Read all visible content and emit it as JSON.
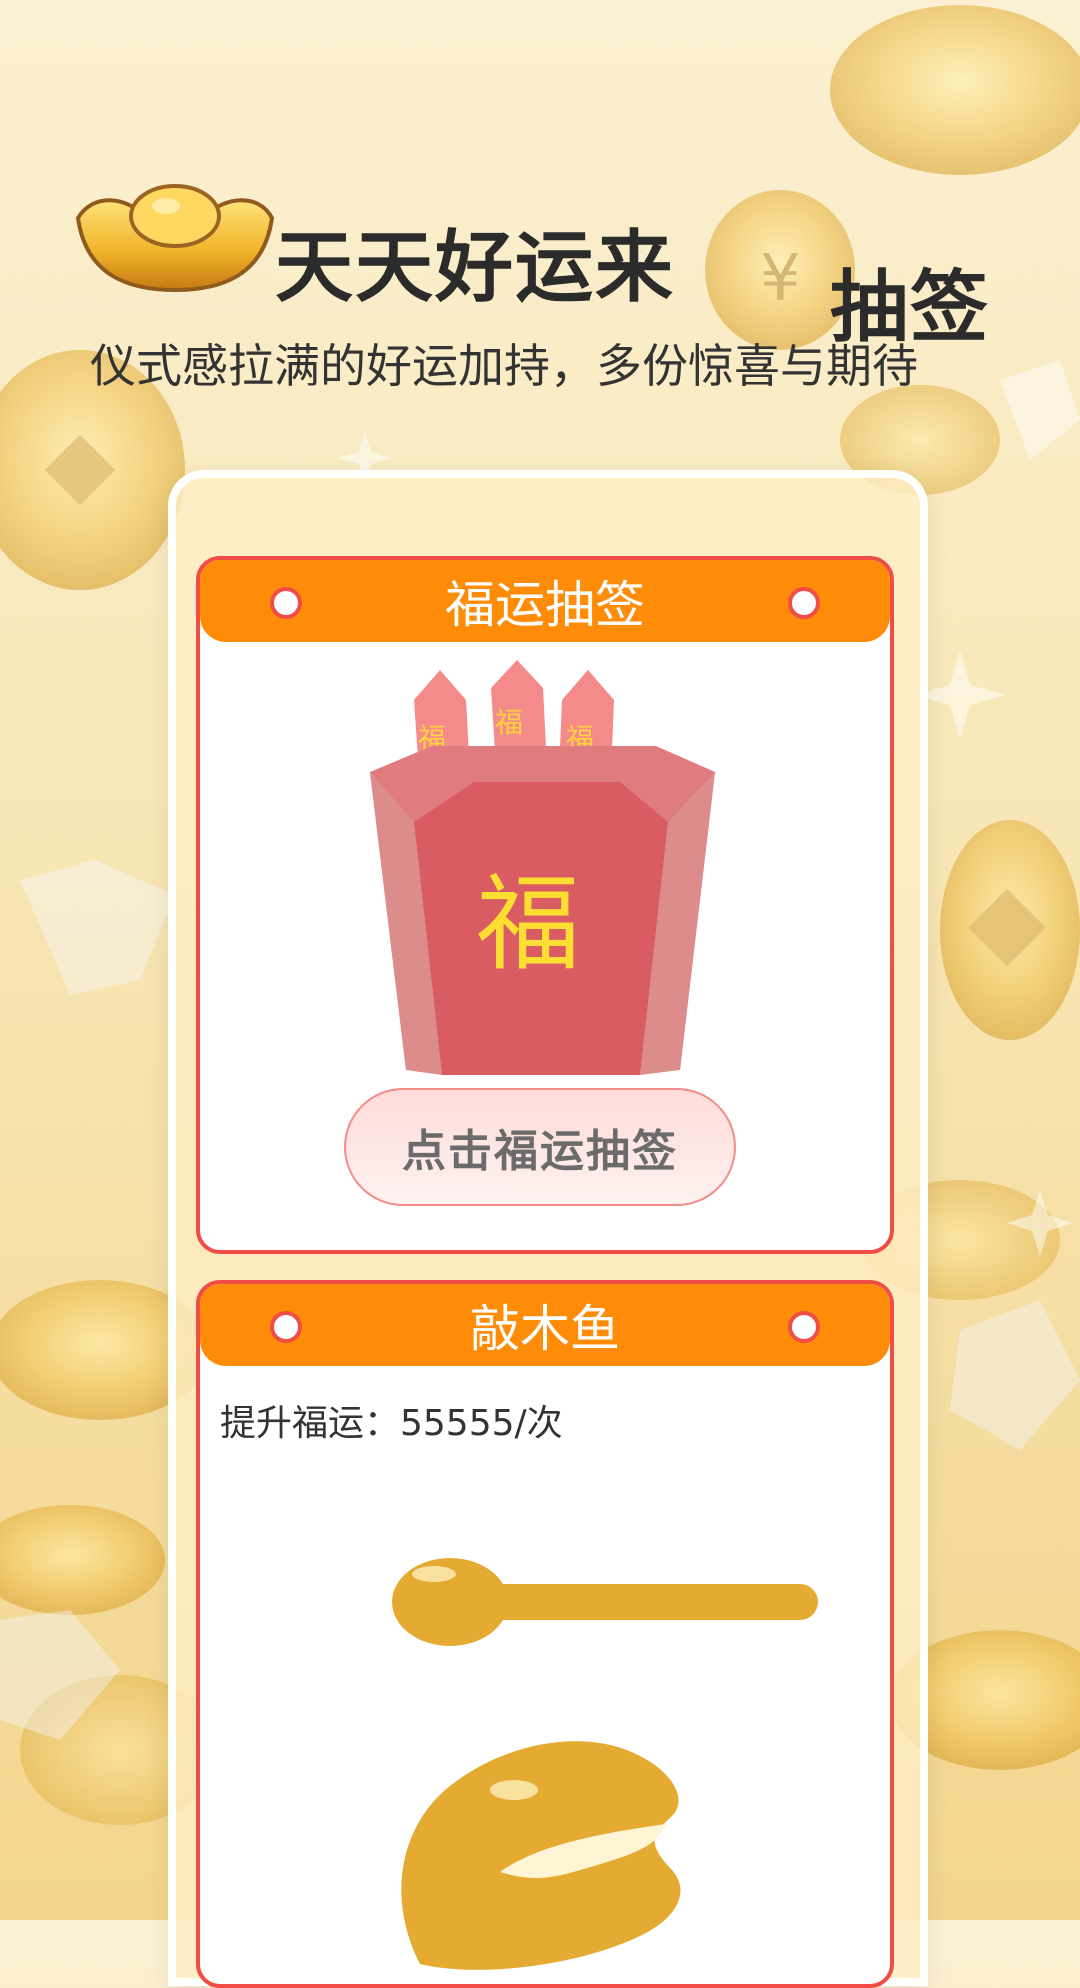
{
  "header": {
    "title": "天天好运来",
    "badge": "抽签",
    "subtitle": "仪式感拉满的好运加持，多份惊喜与期待"
  },
  "lottery_card": {
    "title": "福运抽签",
    "stick_labels": [
      "福",
      "福",
      "福"
    ],
    "cup_label": "福",
    "draw_button_label": "点击福运抽签"
  },
  "wooden_fish_card": {
    "title": "敲木鱼",
    "fortune_text": "提升福运：55555/次"
  },
  "colors": {
    "accent": "#ff8c08",
    "card_border": "#ef4d45",
    "cup_red": "#d85c62",
    "stick_pink": "#f58a8a",
    "gold": "#e4aa31"
  },
  "icons": {
    "decor": "gold-ingot-icon",
    "lottery": "fortune-cup-icon",
    "fish": "wooden-fish-icon",
    "mallet": "mallet-icon"
  }
}
